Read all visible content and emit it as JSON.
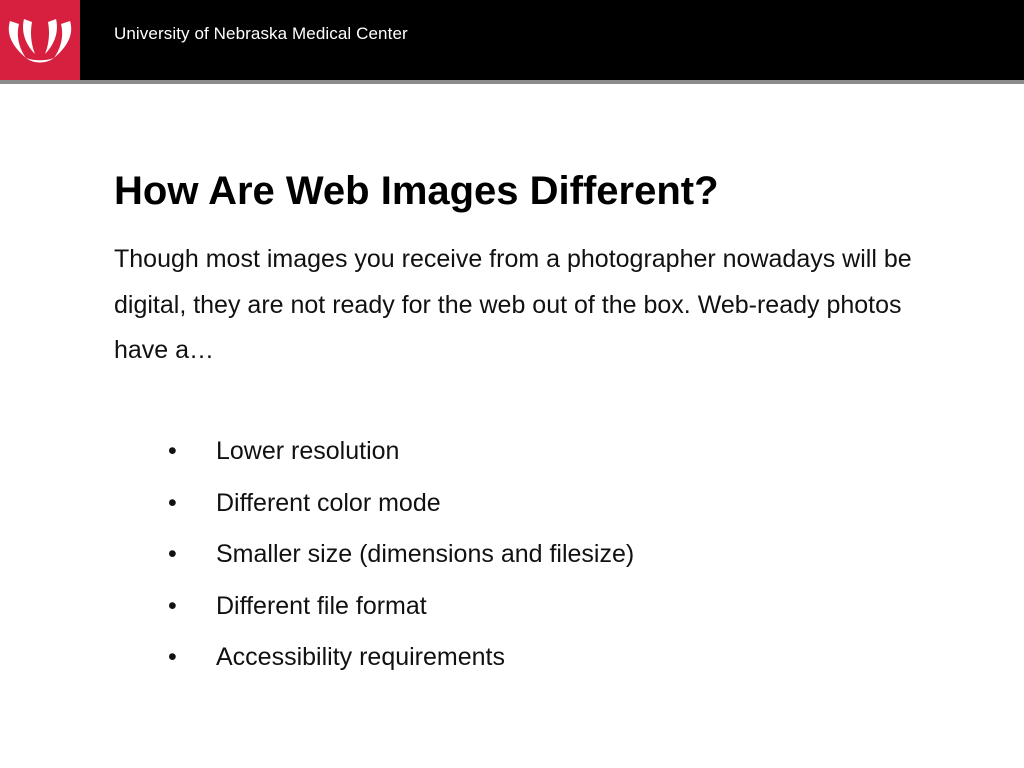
{
  "header": {
    "org_name": "University of Nebraska Medical Center",
    "logo_icon": "unmc-logo-icon",
    "bar_color": "#000000",
    "logo_color": "#d71f3f"
  },
  "slide": {
    "title": "How Are Web Images Different?",
    "intro": "Though most images you receive from a photographer nowadays will be digital, they are not ready for the web out of the box. Web-ready photos have a…",
    "bullet_glyph": "•",
    "bullets": [
      "Lower resolution",
      "Different color mode",
      "Smaller size (dimensions and filesize)",
      "Different file format",
      "Accessibility requirements"
    ]
  }
}
